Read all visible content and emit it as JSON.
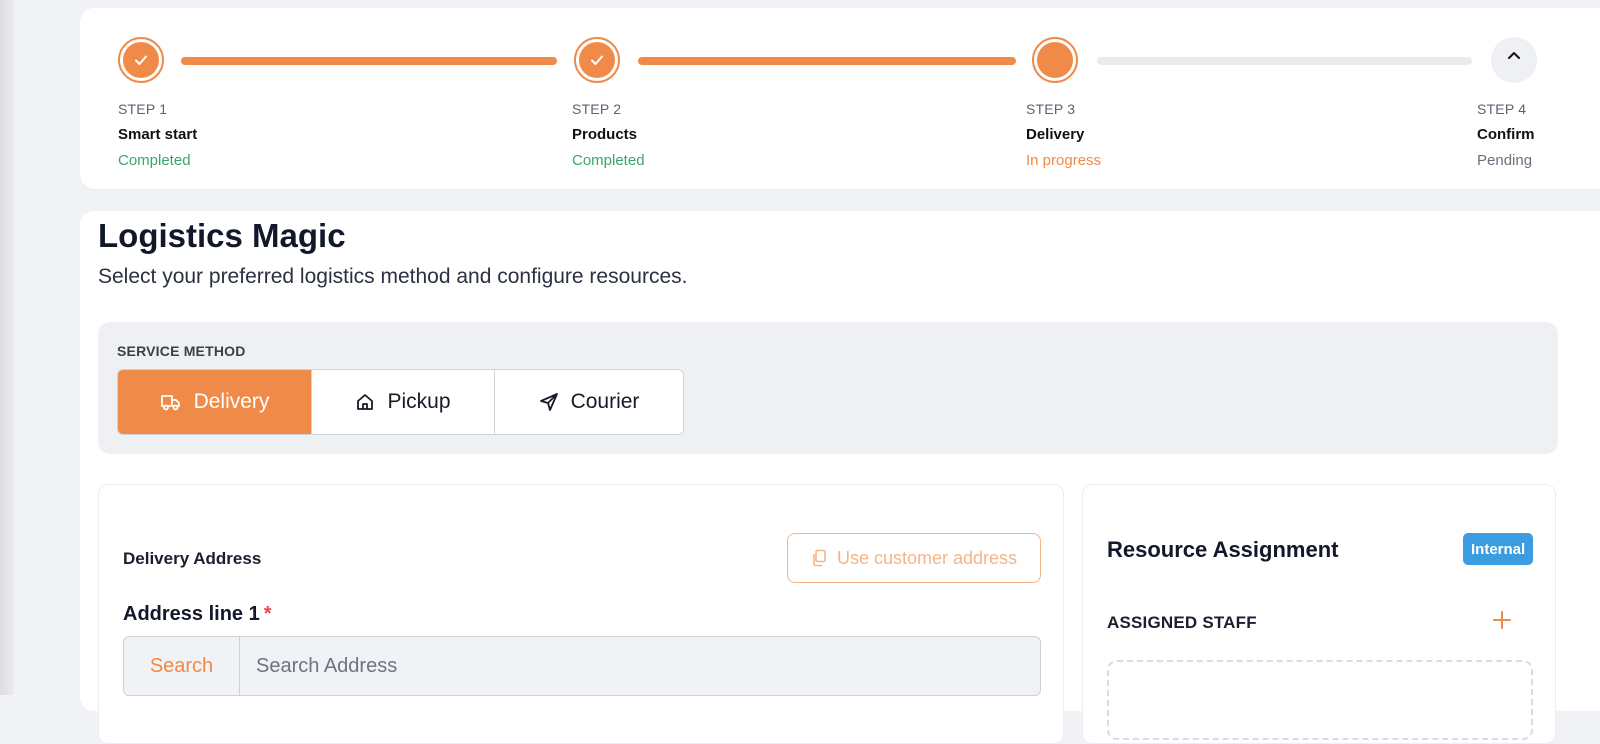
{
  "stepper": {
    "steps": [
      {
        "num": "STEP 1",
        "title": "Smart start",
        "status": "Completed",
        "state": "completed"
      },
      {
        "num": "STEP 2",
        "title": "Products",
        "status": "Completed",
        "state": "completed"
      },
      {
        "num": "STEP 3",
        "title": "Delivery",
        "status": "In progress",
        "state": "in-progress"
      },
      {
        "num": "STEP 4",
        "title": "Confirm",
        "status": "Pending",
        "state": "pending"
      }
    ],
    "colors": {
      "accent": "#f08a48",
      "completed": "#3aa56b",
      "pending": "#6a707c"
    }
  },
  "page": {
    "title": "Logistics Magic",
    "subtitle": "Select your preferred logistics method and configure resources."
  },
  "service": {
    "label": "SERVICE METHOD",
    "methods": [
      {
        "label": "Delivery",
        "icon": "truck-icon",
        "selected": true
      },
      {
        "label": "Pickup",
        "icon": "house-icon",
        "selected": false
      },
      {
        "label": "Courier",
        "icon": "send-icon",
        "selected": false
      }
    ]
  },
  "address": {
    "heading": "Delivery Address",
    "use_customer_label": "Use customer address",
    "field_label": "Address line 1",
    "required_mark": "*",
    "search_label": "Search",
    "placeholder": "Search Address"
  },
  "resource": {
    "title": "Resource Assignment",
    "badge": "Internal",
    "staff_label": "ASSIGNED STAFF",
    "badge_color": "#3b9de0"
  }
}
